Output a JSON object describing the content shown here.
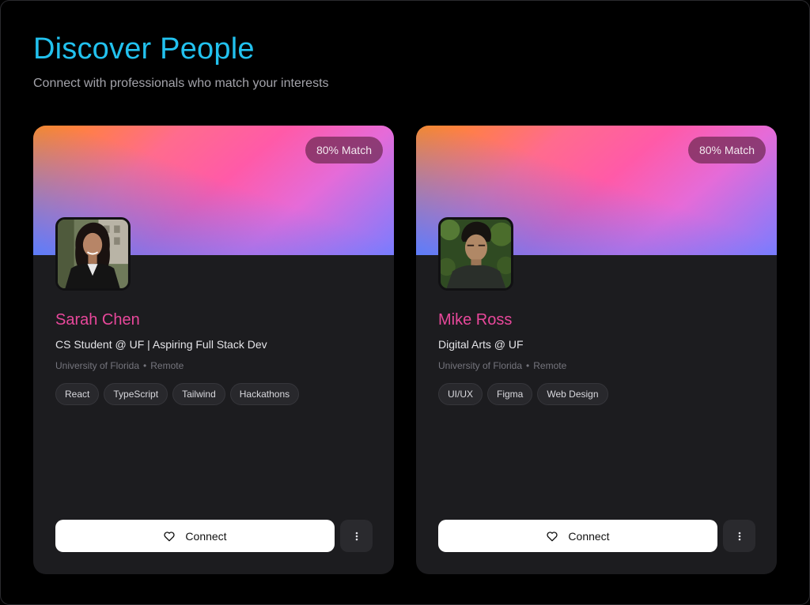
{
  "header": {
    "title": "Discover People",
    "subtitle": "Connect with professionals who match your interests"
  },
  "colors": {
    "accent_title": "#22c1ee",
    "name": "#e8489b",
    "card_bg": "#1c1c1f"
  },
  "cards": [
    {
      "match": "80% Match",
      "name": "Sarah Chen",
      "headline": "CS Student @ UF | Aspiring Full Stack Dev",
      "school": "University of Florida",
      "separator": "•",
      "location": "Remote",
      "tags": [
        "React",
        "TypeScript",
        "Tailwind",
        "Hackathons"
      ],
      "connect_label": "Connect",
      "connect_icon": "heart-icon",
      "more_icon": "more-vertical-icon"
    },
    {
      "match": "80% Match",
      "name": "Mike Ross",
      "headline": "Digital Arts @ UF",
      "school": "University of Florida",
      "separator": "•",
      "location": "Remote",
      "tags": [
        "UI/UX",
        "Figma",
        "Web Design"
      ],
      "connect_label": "Connect",
      "connect_icon": "heart-icon",
      "more_icon": "more-vertical-icon"
    }
  ]
}
